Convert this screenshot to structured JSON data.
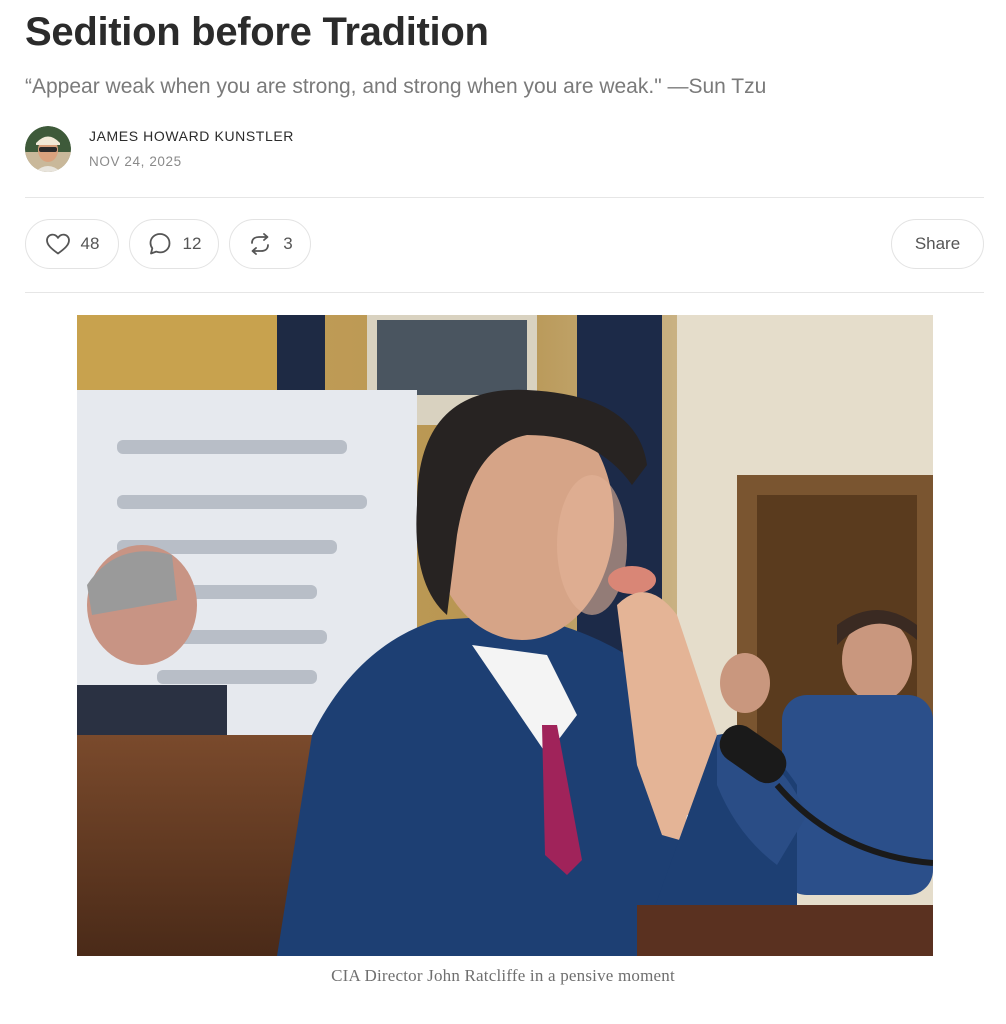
{
  "post": {
    "title": "Sedition before Tradition",
    "subtitle": "“Appear weak when you are strong, and strong when you are weak.\" —Sun Tzu",
    "author": "JAMES HOWARD KUNSTLER",
    "date": "NOV 24, 2025"
  },
  "actions": {
    "likes": "48",
    "comments": "12",
    "restacks": "3",
    "share_label": "Share"
  },
  "image": {
    "caption": "CIA Director John Ratcliffe in a pensive moment"
  },
  "icons": [
    "heart-icon",
    "comment-icon",
    "restack-icon"
  ],
  "colors": {
    "text": "#2b2b2b",
    "muted": "#7a7a7a",
    "border": "#e3e3e3"
  }
}
